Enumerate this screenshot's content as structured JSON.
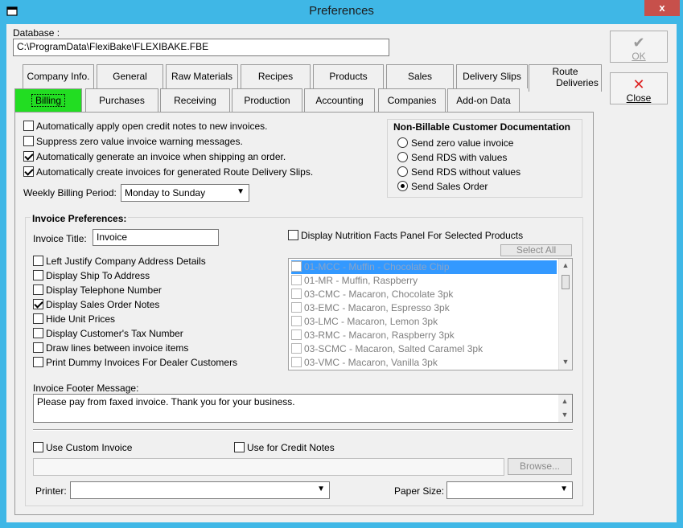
{
  "window": {
    "title": "Preferences",
    "close_glyph": "x"
  },
  "database": {
    "label": "Database :",
    "value": "C:\\ProgramData\\FlexiBake\\FLEXIBAKE.FBE"
  },
  "buttons": {
    "ok": {
      "glyph": "✔",
      "label": "OK"
    },
    "close": {
      "glyph": "✕",
      "label": "Close"
    }
  },
  "tabs_row1": [
    "Company Info.",
    "General",
    "Raw Materials",
    "Recipes",
    "Products",
    "Sales",
    "Delivery Slips"
  ],
  "tab_route": {
    "line1": "Route",
    "line2": "Deliveries"
  },
  "tabs_row2": [
    "Billing",
    "Purchases",
    "Receiving",
    "Production",
    "Accounting",
    "Companies",
    "Add-on Data"
  ],
  "options": [
    {
      "label": "Automatically apply open credit notes to new invoices.",
      "checked": false
    },
    {
      "label": "Suppress zero value invoice warning messages.",
      "checked": false
    },
    {
      "label": "Automatically generate an invoice when shipping an order.",
      "checked": true
    },
    {
      "label": "Automatically create invoices for generated Route Delivery Slips.",
      "checked": true
    }
  ],
  "weekly": {
    "label": "Weekly Billing Period:",
    "value": "Monday to Sunday"
  },
  "non_billable": {
    "title": "Non-Billable Customer Documentation",
    "radios": [
      {
        "label": "Send zero value invoice",
        "checked": false
      },
      {
        "label": "Send RDS with values",
        "checked": false
      },
      {
        "label": "Send RDS without values",
        "checked": false
      },
      {
        "label": "Send Sales Order",
        "checked": true
      }
    ]
  },
  "invoice_prefs": {
    "title": "Invoice Preferences:",
    "invoice_title_label": "Invoice Title:",
    "invoice_title_value": "Invoice",
    "checks": [
      {
        "label": "Left Justify Company Address Details",
        "checked": false
      },
      {
        "label": "Display Ship To Address",
        "checked": false
      },
      {
        "label": "Display Telephone Number",
        "checked": false
      },
      {
        "label": "Display Sales Order Notes",
        "checked": true
      },
      {
        "label": "Hide Unit Prices",
        "checked": false
      },
      {
        "label": "Display Customer's Tax Number",
        "checked": false
      },
      {
        "label": "Draw lines between invoice items",
        "checked": false
      },
      {
        "label": "Print Dummy Invoices For Dealer Customers",
        "checked": false
      }
    ],
    "nutrition_label": "Display Nutrition Facts Panel For Selected Products",
    "select_all": "Select All",
    "products": [
      "01-MCC - Muffin - Chocolate Chip",
      "01-MR - Muffin, Raspberry",
      "03-CMC - Macaron, Chocolate 3pk",
      "03-EMC - Macaron, Espresso 3pk",
      "03-LMC - Macaron, Lemon 3pk",
      "03-RMC - Macaron, Raspberry 3pk",
      "03-SCMC - Macaron, Salted Caramel 3pk",
      "03-VMC - Macaron, Vanilla 3pk"
    ],
    "footer_label": "Invoice Footer Message:",
    "footer_value": "Please pay from faxed invoice. Thank you for your business.",
    "custom_invoice": "Use Custom Invoice",
    "credit_notes": "Use for Credit Notes",
    "browse": "Browse...",
    "printer_label": "Printer:",
    "paper_label": "Paper Size:"
  },
  "colors": {
    "titlebar": "#3fb7e6",
    "active_tab": "#22dd22",
    "close_button": "#c7504b",
    "selection": "#3399ff"
  }
}
